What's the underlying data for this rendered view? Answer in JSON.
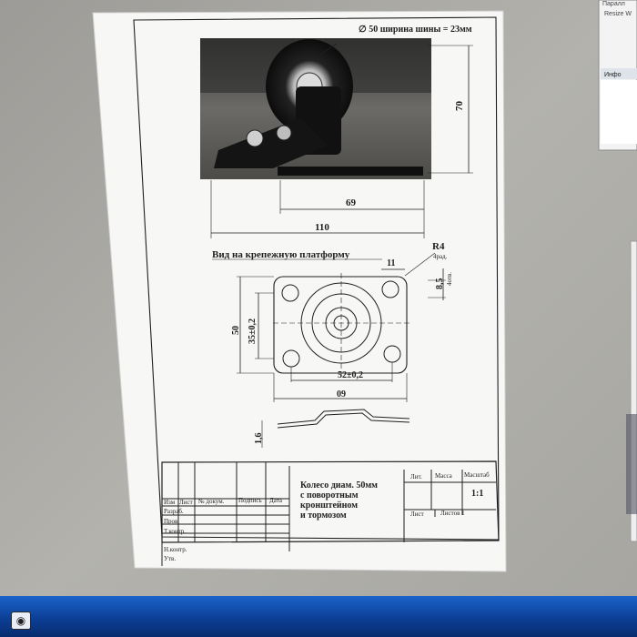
{
  "drawing": {
    "diameter_note": "∅ 50 ширина шины = 23мм",
    "dim_height_70": "70",
    "dim_69": "69",
    "dim_110": "110",
    "view_title": "Вид на крепежную платформу",
    "r4": "R4",
    "r4_sub": "4рад.",
    "dim_11": "11",
    "dim_85": "8,5",
    "dim_85_sub": "4отв.",
    "dim_50": "50",
    "dim_35": "35±0,2",
    "dim_52": "52±0,2",
    "dim_60": "09",
    "dim_16": "1,6"
  },
  "title_block": {
    "part_name_lines": [
      "Колесо диам. 50мм",
      "с поворотным",
      "кронштейном",
      "и тормозом"
    ],
    "header_lit": "Лит.",
    "header_mass": "Масса",
    "header_scale": "Масштаб",
    "scale_value": "1:1",
    "sheet_label": "Лист",
    "sheets_label": "Листов 1",
    "col_headers": [
      "Изм",
      "Лист",
      "№ докум.",
      "Подпись",
      "Дата"
    ],
    "row_labels": [
      "Разраб.",
      "Пров.",
      "Т.контр.",
      "Н.контр.",
      "Утв."
    ]
  },
  "side_panel": {
    "label_top": "Паралл",
    "resize_label": "Resize W",
    "info_label": "Инфо"
  },
  "colors": {
    "wall": "#a9a8a3",
    "paper": "#f7f8f6",
    "ink": "#1f1f1f",
    "taskbar": "#0c3f96"
  }
}
